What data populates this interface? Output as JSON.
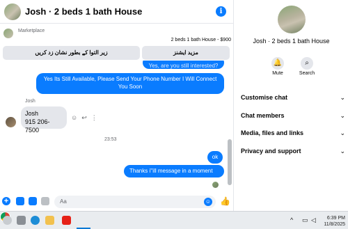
{
  "header": {
    "title": "Josh · 2 beds 1 bath House",
    "info_icon": "info-icon"
  },
  "marketplace": {
    "label": "Marketplace",
    "listing": "2 beds 1 bath House - $900",
    "quick_replies": [
      "زیر التوا کے بطور نشان زد کریں",
      "مزید ایشنز"
    ]
  },
  "thread": {
    "partial_message": "Yes, are you still interested?",
    "messages_out_1": "Yes Its Still Available, Please Send Your Phone Number I Will Connect You Soon",
    "sender_name": "Josh",
    "incoming_line1": "Josh",
    "incoming_line2": "915 206-7500",
    "timestamp": "23:53",
    "messages_out_2": "ok",
    "messages_out_3": "Thanks i''ill message in a moment"
  },
  "composer": {
    "placeholder": "Aa"
  },
  "side_panel": {
    "name": "Josh · 2 beds 1 bath House",
    "actions": [
      "Mute",
      "Search"
    ],
    "sections": [
      "Customise chat",
      "Chat members",
      "Media, files and links",
      "Privacy and support"
    ]
  },
  "taskbar": {
    "time": "6:39 PM",
    "date": "11/8/2025"
  },
  "colors": {
    "accent": "#0a7cff",
    "bubble_in": "#e4e6eb"
  }
}
